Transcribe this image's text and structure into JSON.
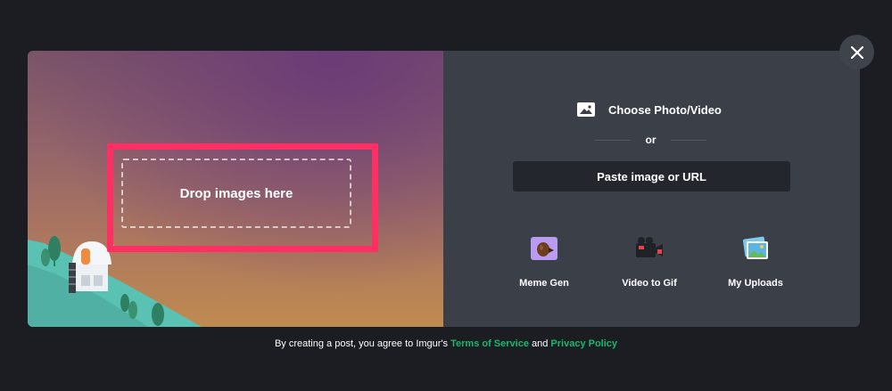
{
  "upload": {
    "drop_label": "Drop images here",
    "choose_label": "Choose Photo/Video",
    "or_label": "or",
    "paste_label": "Paste image or URL"
  },
  "tools": [
    {
      "label": "Meme Gen",
      "icon": "meme-icon"
    },
    {
      "label": "Video to Gif",
      "icon": "video-camera-icon"
    },
    {
      "label": "My Uploads",
      "icon": "photos-icon"
    }
  ],
  "footer": {
    "prefix": "By creating a post, you agree to Imgur's ",
    "terms_label": "Terms of Service",
    "and_label": " and ",
    "privacy_label": "Privacy Policy"
  },
  "colors": {
    "highlight": "#ff2e63",
    "link": "#1bb76e",
    "panel": "#3a3f48",
    "button": "#23262d"
  }
}
